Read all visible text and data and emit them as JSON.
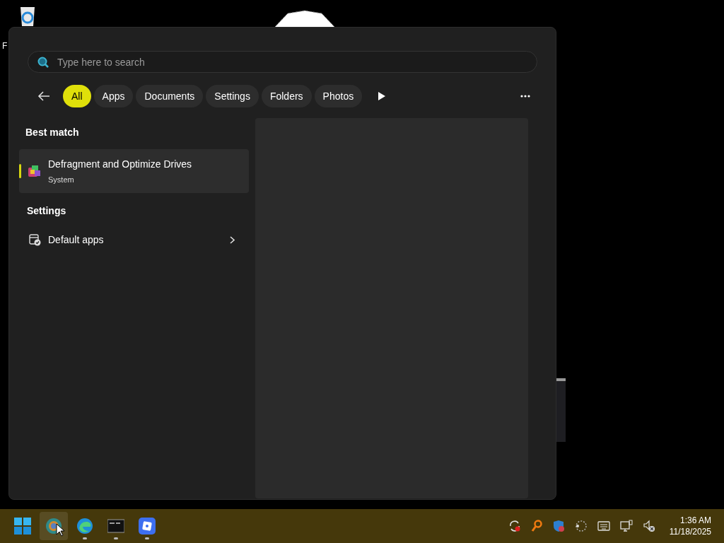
{
  "desktop": {
    "icons": [
      {
        "label": "F"
      }
    ]
  },
  "search": {
    "placeholder": "Type here to search"
  },
  "filters": [
    {
      "label": "All",
      "selected": true
    },
    {
      "label": "Apps",
      "selected": false
    },
    {
      "label": "Documents",
      "selected": false
    },
    {
      "label": "Settings",
      "selected": false
    },
    {
      "label": "Folders",
      "selected": false
    },
    {
      "label": "Photos",
      "selected": false
    }
  ],
  "best_match": {
    "heading": "Best match",
    "items": [
      {
        "title": "Defragment and Optimize Drives",
        "subtitle": "System",
        "selected": true
      }
    ]
  },
  "settings": {
    "heading": "Settings",
    "items": [
      {
        "label": "Default apps"
      }
    ]
  },
  "taskbar": {
    "apps": [
      {
        "kind": "start",
        "running": false
      },
      {
        "kind": "browser",
        "running": false,
        "hovered": true
      },
      {
        "kind": "edge",
        "running": true,
        "hovered": false
      },
      {
        "kind": "terminal",
        "running": true,
        "hovered": false
      },
      {
        "kind": "app",
        "running": true,
        "hovered": false
      }
    ],
    "time": "1:36 AM",
    "date": "11/18/2025"
  }
}
